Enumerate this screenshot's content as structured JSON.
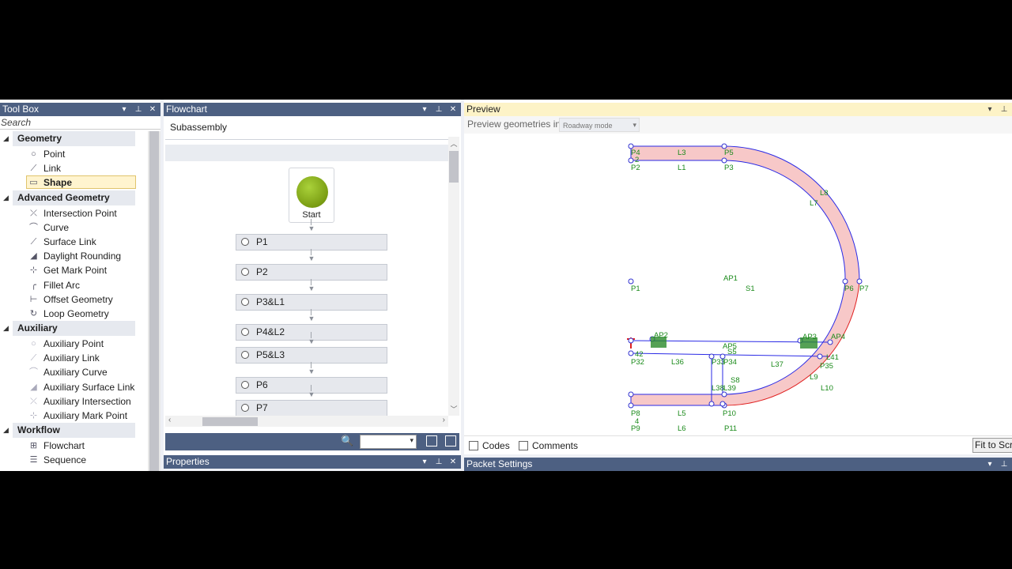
{
  "toolbox": {
    "title": "Tool Box",
    "search_placeholder": "Search",
    "categories": [
      {
        "name": "Geometry",
        "items": [
          {
            "label": "Point",
            "icon": "point-icon"
          },
          {
            "label": "Link",
            "icon": "link-icon"
          },
          {
            "label": "Shape",
            "icon": "shape-icon",
            "selected": true
          }
        ]
      },
      {
        "name": "Advanced Geometry",
        "items": [
          {
            "label": "Intersection Point",
            "icon": "intersection-point-icon"
          },
          {
            "label": "Curve",
            "icon": "curve-icon"
          },
          {
            "label": "Surface Link",
            "icon": "surface-link-icon"
          },
          {
            "label": "Daylight Rounding",
            "icon": "daylight-rounding-icon"
          },
          {
            "label": "Get Mark Point",
            "icon": "get-mark-point-icon"
          },
          {
            "label": "Fillet Arc",
            "icon": "fillet-arc-icon"
          },
          {
            "label": "Offset Geometry",
            "icon": "offset-geometry-icon"
          },
          {
            "label": "Loop Geometry",
            "icon": "loop-geometry-icon"
          }
        ]
      },
      {
        "name": "Auxiliary",
        "items": [
          {
            "label": "Auxiliary Point",
            "icon": "auxiliary-point-icon"
          },
          {
            "label": "Auxiliary Link",
            "icon": "auxiliary-link-icon"
          },
          {
            "label": "Auxiliary Curve",
            "icon": "auxiliary-curve-icon"
          },
          {
            "label": "Auxiliary Surface Link",
            "icon": "auxiliary-surface-link-icon"
          },
          {
            "label": "Auxiliary Intersection",
            "icon": "auxiliary-intersection-icon"
          },
          {
            "label": "Auxiliary Mark Point",
            "icon": "auxiliary-mark-point-icon"
          }
        ]
      },
      {
        "name": "Workflow",
        "items": [
          {
            "label": "Flowchart",
            "icon": "flowchart-icon"
          },
          {
            "label": "Sequence",
            "icon": "sequence-icon"
          }
        ]
      }
    ]
  },
  "flowchart": {
    "title": "Flowchart",
    "subassembly_label": "Subassembly",
    "start_label": "Start",
    "nodes": [
      "P1",
      "P2",
      "P3&L1",
      "P4&L2",
      "P5&L3",
      "P6",
      "P7"
    ]
  },
  "properties": {
    "title": "Properties"
  },
  "preview": {
    "title": "Preview",
    "mode_label": "Preview geometries in",
    "mode_value": "Roadway mode",
    "codes_label": "Codes",
    "comments_label": "Comments",
    "fit_button": "Fit to Screen",
    "geometry_labels": [
      "P4",
      "L3",
      "P5",
      "2",
      "P2",
      "L1",
      "P3",
      "L8",
      "L7",
      "AP1",
      "P1",
      "S1",
      "P6",
      "P7",
      "AP2",
      "AP3",
      "AP4",
      "P32",
      "L36",
      "P33",
      "P34",
      "L37",
      "L41",
      "P35",
      "S8",
      "L9",
      "L10",
      "L38",
      "L39",
      "P8",
      "L5",
      "P10",
      "4",
      "P9",
      "L6",
      "P11",
      "42",
      "AP5",
      "S5"
    ]
  },
  "packet_settings": {
    "title": "Packet Settings"
  },
  "colors": {
    "panel_header": "#4d6082",
    "preview_header": "#fdf3c7",
    "shape_fill": "#f7c8c8",
    "link_blue": "#2020e0",
    "label_green": "#1a8a1a",
    "start_green": "#8db51e"
  }
}
